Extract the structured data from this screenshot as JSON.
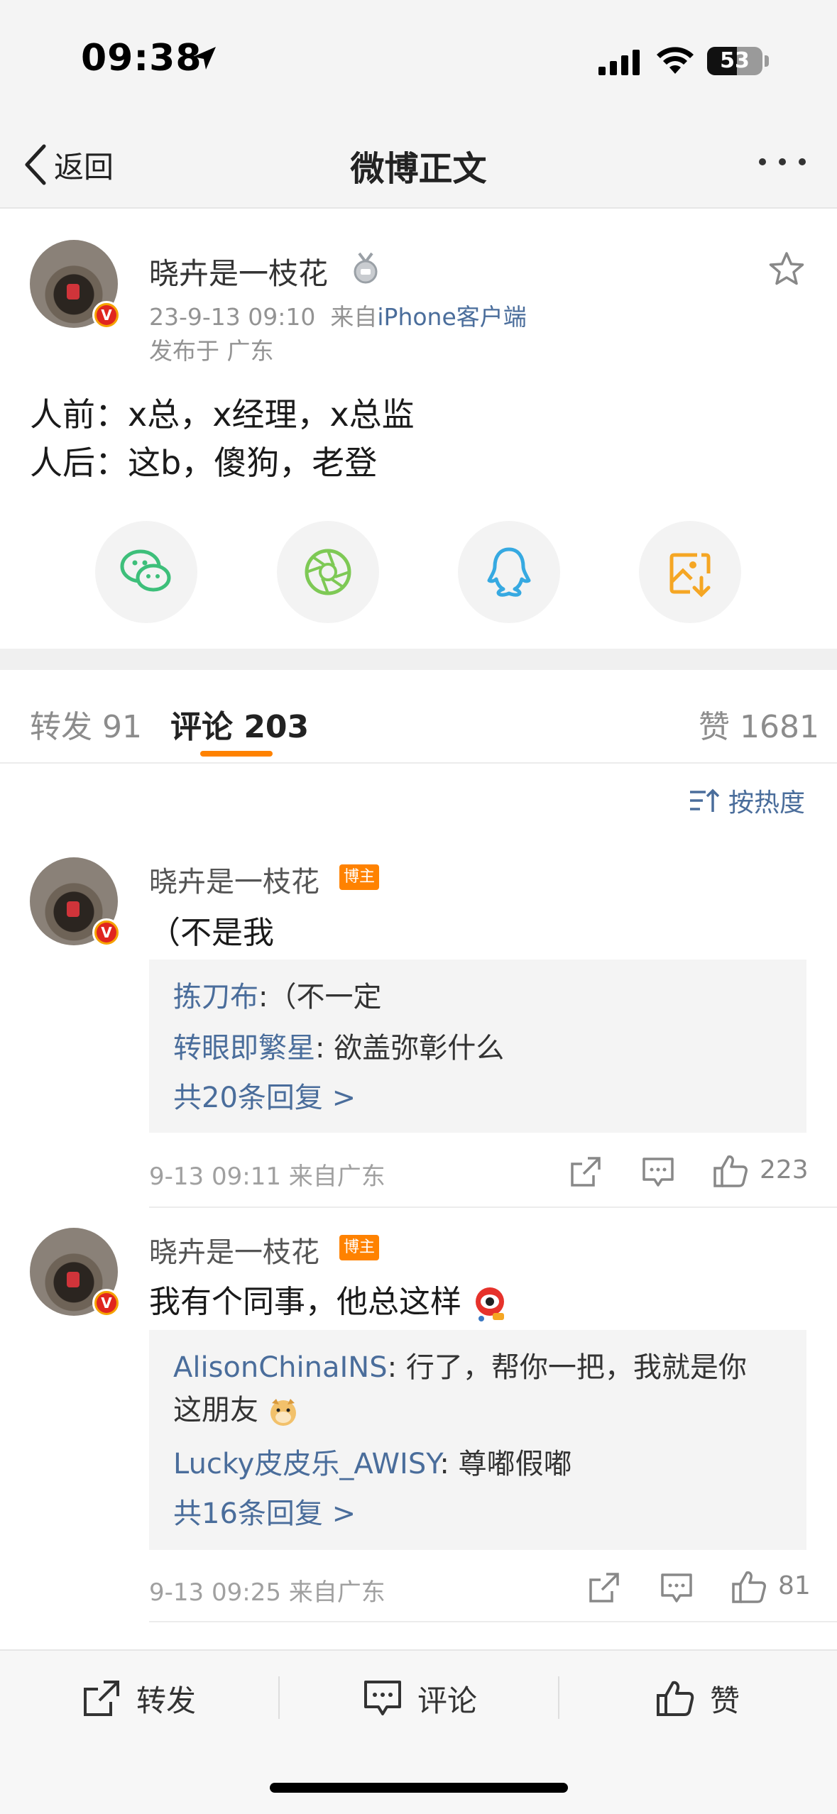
{
  "status_bar": {
    "time": "09:38",
    "battery": "53",
    "battery_level": 0.53
  },
  "nav": {
    "back_label": "返回",
    "title": "微博正文"
  },
  "post": {
    "author": "晓卉是一枝花",
    "date": "23-9-13 09:10",
    "from_prefix": "来自",
    "source": "iPhone客户端",
    "location": "发布于 广东",
    "lines": [
      "人前：x总，x经理，x总监",
      "人后：这b，傻狗，老登"
    ],
    "verified_mark": "V"
  },
  "share": [
    "wechat-icon",
    "moments-icon",
    "qq-icon",
    "save-image-icon"
  ],
  "tabs": {
    "repost": "转发 91",
    "comments": "评论 203",
    "likes": "赞 1681"
  },
  "sort_label": "按热度",
  "comments": [
    {
      "name": "晓卉是一枝花",
      "badge": "博主",
      "text": "（不是我",
      "replies": [
        {
          "who": "拣刀布",
          "text": ":（不一定"
        },
        {
          "who": "转眼即繁星",
          "text": ": 欲盖弥彰什么"
        }
      ],
      "more": "共20条回复 >",
      "meta": "9-13 09:11  来自广东",
      "likes": "223"
    },
    {
      "name": "晓卉是一枝花",
      "badge": "博主",
      "text": "我有个同事，他总这样",
      "replies": [
        {
          "who": "AlisonChinaINS",
          "text": ": 行了，帮你一把，我就是你",
          "cont": "这朋友"
        },
        {
          "who": "Lucky皮皮乐_AWISY",
          "text": ": 尊嘟假嘟"
        }
      ],
      "more": "共16条回复 >",
      "meta": "9-13 09:25  来自广东",
      "likes": "81"
    }
  ],
  "bottom_bar": {
    "repost": "转发",
    "comment": "评论",
    "like": "赞"
  },
  "colors": {
    "accent": "#ff8200",
    "link": "#4a6d9b",
    "wechat": "#3dbf7a",
    "moments": "#7ec955",
    "qq": "#36a9e1",
    "save": "#f5a623"
  }
}
